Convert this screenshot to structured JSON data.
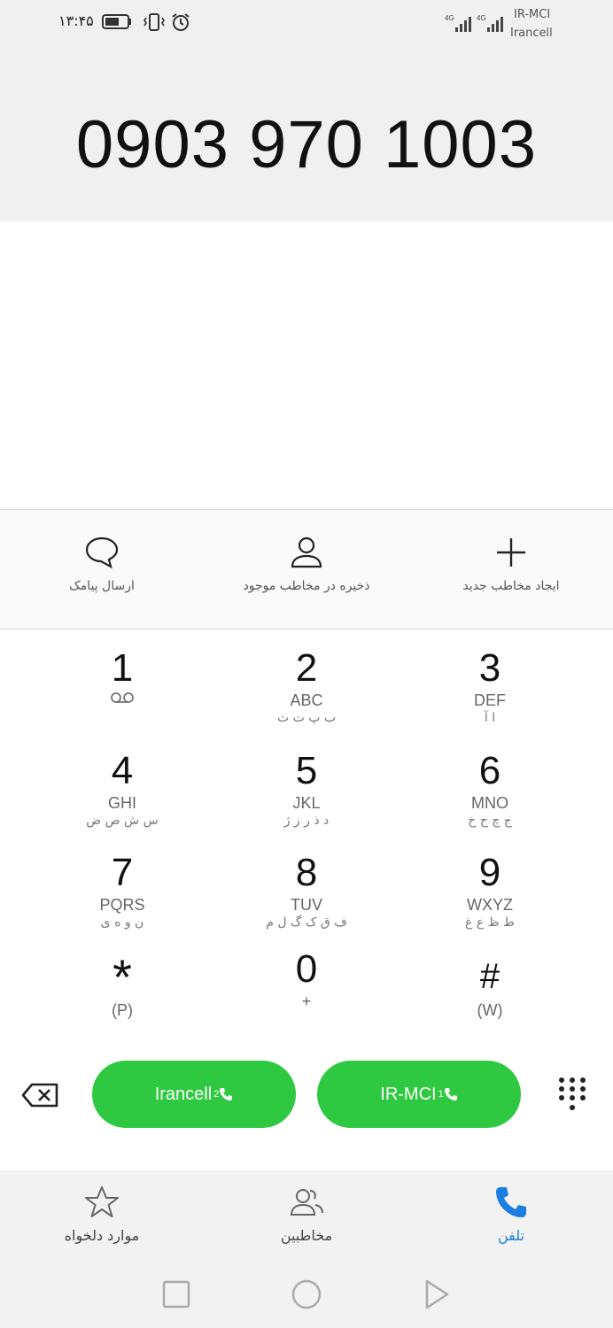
{
  "status_bar": {
    "time": "۱۳:۴۵",
    "carriers": [
      "IR-MCI",
      "Irancell"
    ],
    "network": [
      "4G",
      "4G"
    ],
    "icons": [
      "battery-icon",
      "vibrate-icon",
      "alarm-icon",
      "signal-icon"
    ]
  },
  "dialer": {
    "number": "0903 970 1003"
  },
  "actions": [
    {
      "label": "ارسال پیامک",
      "icon": "message-icon"
    },
    {
      "label": "ذخیره در مخاطب موجود",
      "icon": "person-icon"
    },
    {
      "label": "ایجاد مخاطب جدید",
      "icon": "plus-icon"
    }
  ],
  "keypad": [
    {
      "digit": "1",
      "letters": "",
      "farsi": ""
    },
    {
      "digit": "2",
      "letters": "ABC",
      "farsi": "ب پ ت ث"
    },
    {
      "digit": "3",
      "letters": "DEF",
      "farsi": "ا آ"
    },
    {
      "digit": "4",
      "letters": "GHI",
      "farsi": "س ش ص ض"
    },
    {
      "digit": "5",
      "letters": "JKL",
      "farsi": "د ذ ر ز ژ"
    },
    {
      "digit": "6",
      "letters": "MNO",
      "farsi": "ج چ ح خ"
    },
    {
      "digit": "7",
      "letters": "PQRS",
      "farsi": "ن و ه ی"
    },
    {
      "digit": "8",
      "letters": "TUV",
      "farsi": "ف ق ک گ ل م"
    },
    {
      "digit": "9",
      "letters": "WXYZ",
      "farsi": "ط ظ ع غ"
    },
    {
      "digit": "*",
      "letters": "(P)",
      "farsi": ""
    },
    {
      "digit": "0",
      "letters": "+",
      "farsi": ""
    },
    {
      "digit": "#",
      "letters": "(W)",
      "farsi": ""
    }
  ],
  "call_buttons": [
    {
      "label": "Irancell",
      "sim": "2"
    },
    {
      "label": "IR-MCI",
      "sim": "1"
    }
  ],
  "bottom_nav": [
    {
      "label": "موارد دلخواه",
      "icon": "star-icon"
    },
    {
      "label": "مخاطبین",
      "icon": "contacts-icon"
    },
    {
      "label": "تلفن",
      "icon": "phone-icon",
      "active": true
    }
  ],
  "colors": {
    "call_green": "#2ec940",
    "active_blue": "#1a7fe0",
    "top_bg": "#f0f0f0"
  }
}
